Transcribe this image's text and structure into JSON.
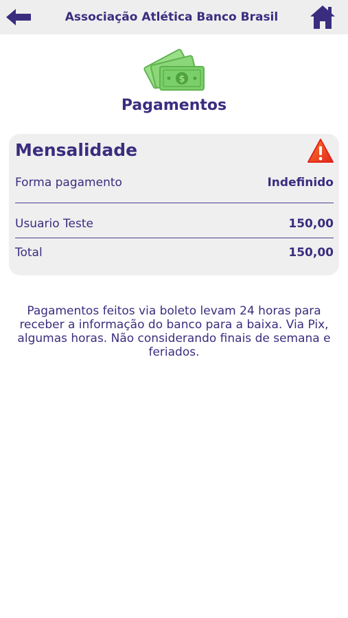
{
  "header": {
    "title": "Associação Atlética Banco Brasil"
  },
  "page": {
    "title": "Pagamentos"
  },
  "card": {
    "title": "Mensalidade",
    "payment_method_label": "Forma pagamento",
    "payment_method_value": "Indefinido",
    "item_label": "Usuario Teste",
    "item_value": "150,00",
    "total_label": "Total",
    "total_value": "150,00"
  },
  "notice": {
    "text": "Pagamentos feitos via boleto levam 24 horas para receber a informação do banco para a baixa. Via Pix, algumas horas. Não considerando finais de semana e feriados."
  },
  "icons": {
    "back": "arrow-left-icon",
    "home": "home-icon",
    "money": "money-bills-icon",
    "warning": "warning-triangle-icon"
  },
  "colors": {
    "primary": "#3a2d7f",
    "header_bg": "#eeeeee",
    "card_bg": "#efefef",
    "money_green": "#7bcf6a",
    "warning_red": "#e53a1e"
  }
}
